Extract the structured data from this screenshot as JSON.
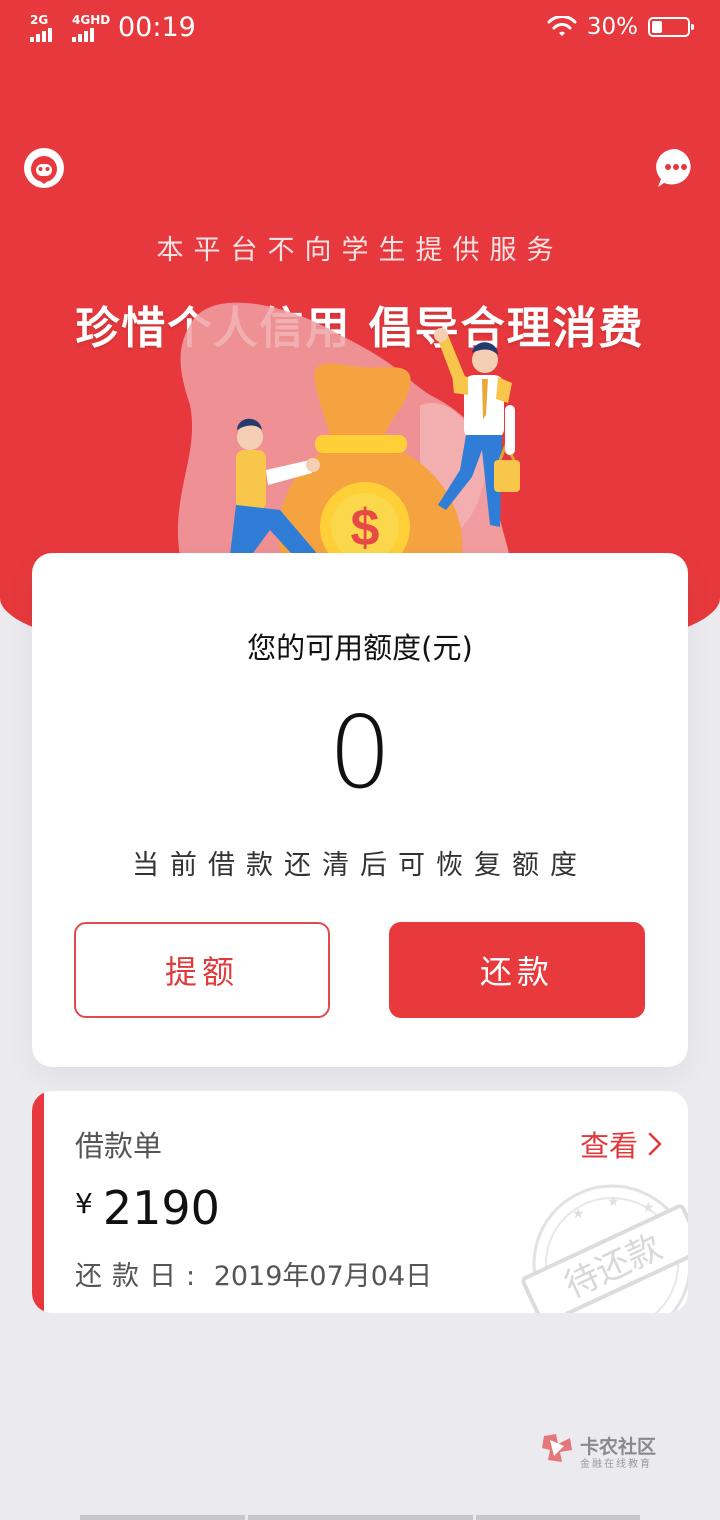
{
  "status_bar": {
    "network1": "2G",
    "network2": "4GHD",
    "time": "00:19",
    "battery_text": "30%",
    "battery_level": 0.3
  },
  "header": {
    "left_icon": "robot-service-icon",
    "right_icon": "chat-bubble-icon",
    "tagline": "本平台不向学生提供服务",
    "slogan": "珍惜个人信用 倡导合理消费"
  },
  "credit": {
    "title": "您的可用额度(元)",
    "amount": "0",
    "note": "当前借款还清后可恢复额度",
    "raise_button": "提额",
    "repay_button": "还款"
  },
  "loan": {
    "title": "借款单",
    "view_label": "查看",
    "currency": "¥",
    "amount": "2190",
    "date_label": "还款日:",
    "date_value": "2019年07月04日",
    "stamp_text": "待还款"
  },
  "watermark": {
    "title": "卡农社区",
    "subtitle": "金融在线教育"
  },
  "colors": {
    "primary_red": "#e7393d",
    "background": "#ebebef"
  }
}
